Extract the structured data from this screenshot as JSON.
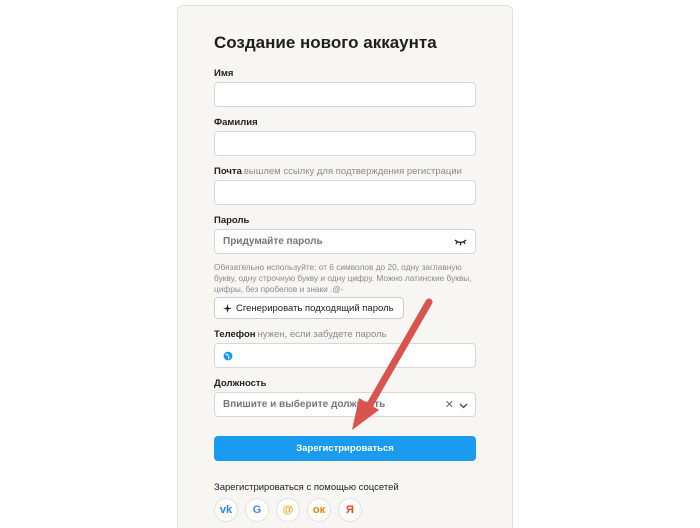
{
  "form": {
    "title": "Создание нового аккаунта",
    "first_name": {
      "label": "Имя",
      "value": ""
    },
    "last_name": {
      "label": "Фамилия",
      "value": ""
    },
    "email": {
      "label": "Почта",
      "hint": "вышлем ссылку для подтверждения регистрации",
      "value": ""
    },
    "password": {
      "label": "Пароль",
      "placeholder": "Придумайте пароль",
      "note": "Обязательно используйте: от 6 символов до 20, одну заглавную букву, одну строчную букву и одну цифру. Можно латинские буквы, цифры, без пробелов и знаки .@-"
    },
    "generate_label": "Сгенерировать подходящий пароль",
    "phone": {
      "label": "Телефон",
      "hint": "нужен, если забудете пароль",
      "value": ""
    },
    "position": {
      "label": "Должность",
      "placeholder": "Впишите и выберите должность"
    },
    "submit_label": "Зарегистрироваться",
    "social_label": "Зарегистрироваться с помощью соцсетей"
  },
  "social": [
    {
      "icon": "vk-icon",
      "glyph": "vk",
      "color": "#2787f5"
    },
    {
      "icon": "google-icon",
      "glyph": "G",
      "color": "#4285f4"
    },
    {
      "icon": "mail-at-icon",
      "glyph": "@",
      "color": "#f5a623"
    },
    {
      "icon": "odnoklassniki-icon",
      "glyph": "ок",
      "color": "#ee8208"
    },
    {
      "icon": "yandex-icon",
      "glyph": "Я",
      "color": "#fc3f1d"
    }
  ],
  "colors": {
    "accent": "#1a9bf0",
    "annotation_arrow": "#d9534f"
  }
}
